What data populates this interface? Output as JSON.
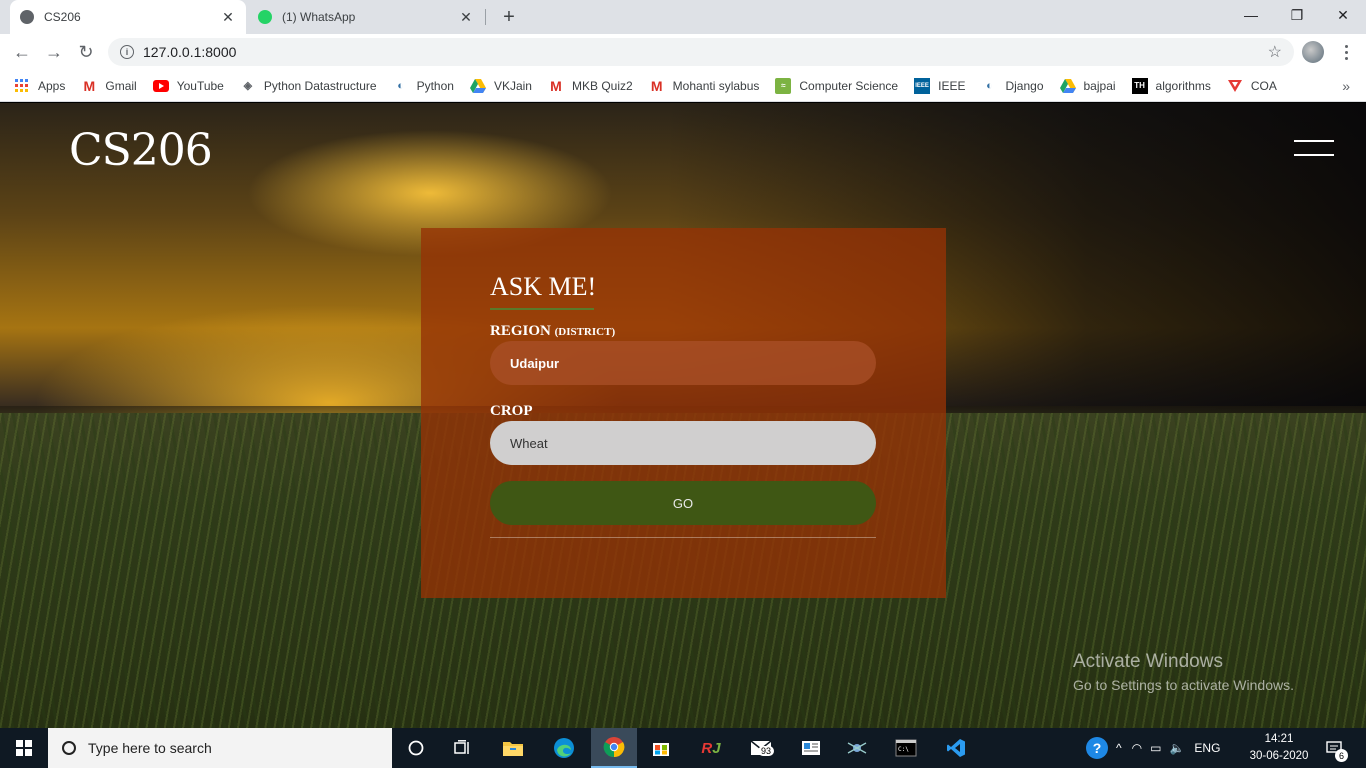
{
  "browser": {
    "tabs": [
      {
        "title": "CS206",
        "favicon_color": "#5f6368"
      },
      {
        "title": "(1) WhatsApp",
        "favicon_color": "#25d366",
        "badge": "1"
      }
    ],
    "address": "127.0.0.1:8000",
    "bookmarks": [
      {
        "label": "Apps",
        "icon": "apps-grid-icon",
        "color": "#4285f4"
      },
      {
        "label": "Gmail",
        "icon": "gmail-icon",
        "color": "#d93025"
      },
      {
        "label": "YouTube",
        "icon": "youtube-icon",
        "color": "#ff0000"
      },
      {
        "label": "Python Datastructure",
        "icon": "diamond-icon",
        "color": "#5f6368"
      },
      {
        "label": "Python",
        "icon": "python-icon",
        "color": "#3572a5"
      },
      {
        "label": "VKJain",
        "icon": "drive-icon",
        "color": "#1fa463"
      },
      {
        "label": "MKB Quiz2",
        "icon": "gmail-icon",
        "color": "#d93025"
      },
      {
        "label": "Mohanti sylabus",
        "icon": "gmail-icon",
        "color": "#d93025"
      },
      {
        "label": "Computer Science",
        "icon": "cs-icon",
        "color": "#7cb342"
      },
      {
        "label": "IEEE",
        "icon": "ieee-icon",
        "color": "#00629b"
      },
      {
        "label": "Django",
        "icon": "django-icon",
        "color": "#3572a5"
      },
      {
        "label": "bajpai",
        "icon": "drive-icon",
        "color": "#1fa463"
      },
      {
        "label": "algorithms",
        "icon": "th-icon",
        "color": "#000000"
      },
      {
        "label": "COA",
        "icon": "coa-icon",
        "color": "#e53935"
      }
    ]
  },
  "page": {
    "brand": "CS206",
    "form": {
      "title": "ASK ME!",
      "region_label": "REGION",
      "region_sublabel": "(DISTRICT)",
      "region_value": "Udaipur",
      "crop_label": "CROP",
      "crop_value": "Wheat",
      "go_label": "GO"
    },
    "watermark": {
      "line1": "Activate Windows",
      "line2": "Go to Settings to activate Windows."
    }
  },
  "taskbar": {
    "search_placeholder": "Type here to search",
    "mail_count": "93",
    "language": "ENG",
    "time": "14:21",
    "date": "30-06-2020",
    "notifications": "6"
  }
}
